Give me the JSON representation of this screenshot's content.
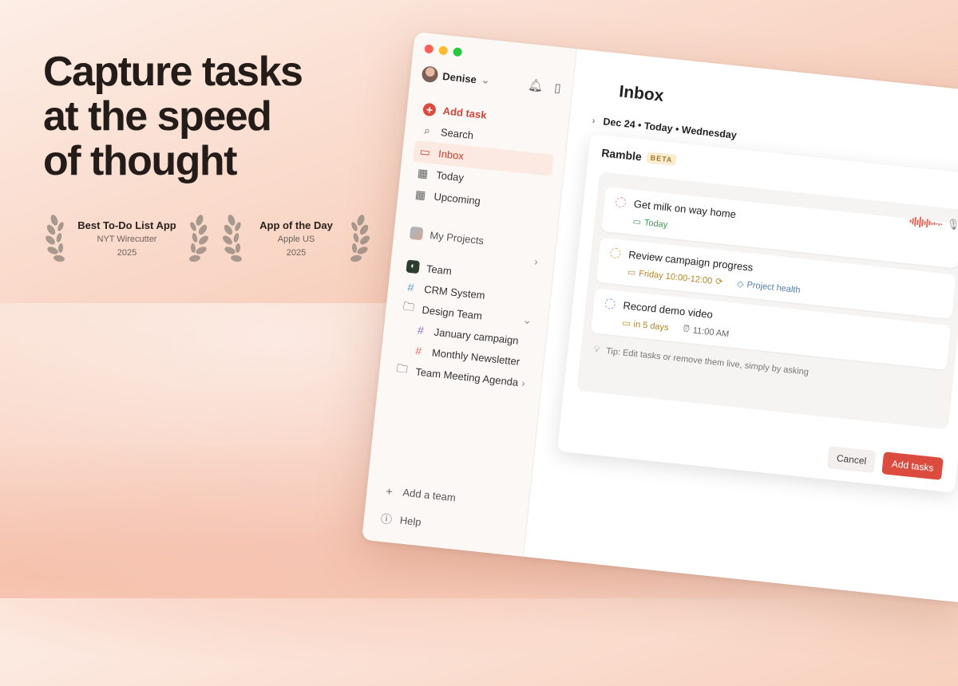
{
  "headline": "Capture tasks\nat the speed\nof thought",
  "awards": [
    {
      "title": "Best To-Do List App",
      "source": "NYT Wirecutter",
      "year": "2025"
    },
    {
      "title": "App of the Day",
      "source": "Apple US",
      "year": "2025"
    }
  ],
  "sidebar": {
    "user_name": "Denise",
    "nav": [
      {
        "label": "Add task",
        "icon": "plus-icon"
      },
      {
        "label": "Search",
        "icon": "search-icon"
      },
      {
        "label": "Inbox",
        "icon": "inbox-icon"
      },
      {
        "label": "Today",
        "icon": "calendar-today-icon"
      },
      {
        "label": "Upcoming",
        "icon": "calendar-grid-icon"
      }
    ],
    "my_projects": "My Projects",
    "team": "Team",
    "projects": [
      {
        "label": "CRM System",
        "icon": "hash-icon"
      },
      {
        "label": "Design Team",
        "icon": "folder-icon"
      },
      {
        "label": "January campaign",
        "icon": "hash-icon"
      },
      {
        "label": "Monthly Newsletter",
        "icon": "hash-icon"
      },
      {
        "label": "Team Meeting Agenda",
        "icon": "folder-icon"
      }
    ],
    "add_team": "Add a team",
    "help": "Help"
  },
  "main": {
    "title": "Inbox",
    "date_label": "Dec 24 • Today • Wednesday",
    "ramble": {
      "title": "Ramble",
      "badge": "BETA",
      "tasks": [
        {
          "text": "Get milk on way home",
          "date": "Today",
          "date_color": "#3a9b50",
          "circle_color": "#e59aa9"
        },
        {
          "text": "Review campaign progress",
          "date": "Friday 10:00-12:00",
          "date_color": "#b5861f",
          "circle_color": "#d9b270",
          "tag": "Project health",
          "tag_color": "#4f82b8"
        },
        {
          "text": "Record demo video",
          "date": "in 5 days",
          "date_color": "#b5861f",
          "circle_color": "#8fa8d8",
          "reminder": "11:00 AM"
        }
      ],
      "tip": "Tip: Edit tasks or remove them live, simply by asking",
      "cancel": "Cancel",
      "submit": "Add tasks"
    }
  }
}
